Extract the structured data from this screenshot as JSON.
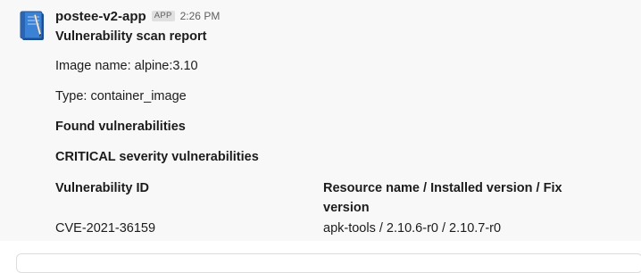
{
  "message": {
    "sender": "postee-v2-app",
    "badge": "APP",
    "time": "2:26 PM",
    "title": "Vulnerability scan report",
    "image_name": "Image name: alpine:3.10",
    "type": "Type: container_image",
    "found_heading": "Found vulnerabilities",
    "severity_heading": "CRITICAL severity vulnerabilities",
    "table": {
      "headers": [
        "Vulnerability ID",
        "Resource name / Installed version / Fix version"
      ],
      "rows": [
        [
          "CVE-2021-36159",
          "apk-tools / 2.10.6-r0 / 2.10.7-r0"
        ]
      ]
    }
  },
  "colors": {
    "message_bg": "#f8f8f8",
    "text": "#1d1c1d",
    "muted": "#616061",
    "avatar_blue": "#2f6fc1"
  },
  "icons": {
    "avatar": "notebook-icon"
  }
}
